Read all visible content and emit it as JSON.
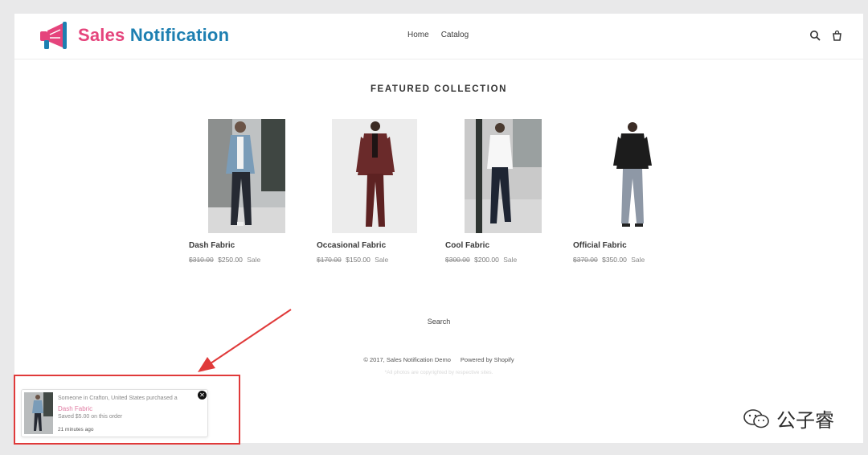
{
  "header": {
    "logo_word1": "Sales",
    "logo_word2": "Notification",
    "nav": [
      "Home",
      "Catalog"
    ],
    "icons": [
      "search-icon",
      "cart-icon"
    ]
  },
  "section_title": "FEATURED COLLECTION",
  "products": [
    {
      "name": "Dash Fabric",
      "old_price": "$310.00",
      "price": "$250.00",
      "badge": "Sale"
    },
    {
      "name": "Occasional Fabric",
      "old_price": "$170.00",
      "price": "$150.00",
      "badge": "Sale"
    },
    {
      "name": "Cool Fabric",
      "old_price": "$300.00",
      "price": "$200.00",
      "badge": "Sale"
    },
    {
      "name": "Official Fabric",
      "old_price": "$370.00",
      "price": "$350.00",
      "badge": "Sale"
    }
  ],
  "footer": {
    "search_link": "Search",
    "copyright": "© 2017, Sales Notification Demo",
    "powered": "Powered by Shopify",
    "note": "*All photos are copyrighted by respective sites."
  },
  "popup": {
    "message": "Someone in Crafton, United States purchased a",
    "product": "Dash Fabric",
    "saved": "Saved $5.00 on this order",
    "time": "21 minutes ago",
    "close_icon": "close-icon"
  },
  "watermark": "公子睿",
  "colors": {
    "logo_pink": "#e5447c",
    "logo_blue": "#1d7fb1",
    "annotation_red": "#e03a3a",
    "popup_product_pink": "#e07ba2"
  }
}
